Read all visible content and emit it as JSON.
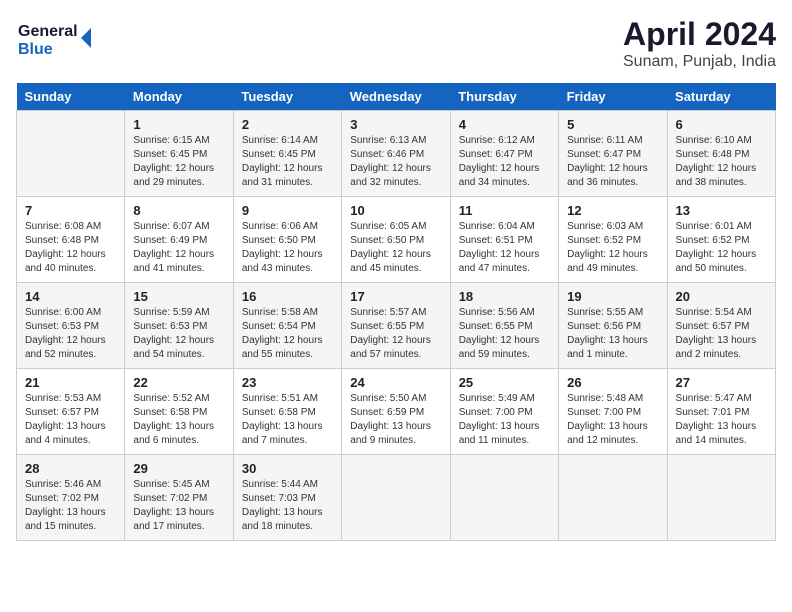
{
  "header": {
    "logo_line1": "General",
    "logo_line2": "Blue",
    "title": "April 2024",
    "subtitle": "Sunam, Punjab, India"
  },
  "days_of_week": [
    "Sunday",
    "Monday",
    "Tuesday",
    "Wednesday",
    "Thursday",
    "Friday",
    "Saturday"
  ],
  "weeks": [
    [
      {
        "day": "",
        "info": ""
      },
      {
        "day": "1",
        "info": "Sunrise: 6:15 AM\nSunset: 6:45 PM\nDaylight: 12 hours\nand 29 minutes."
      },
      {
        "day": "2",
        "info": "Sunrise: 6:14 AM\nSunset: 6:45 PM\nDaylight: 12 hours\nand 31 minutes."
      },
      {
        "day": "3",
        "info": "Sunrise: 6:13 AM\nSunset: 6:46 PM\nDaylight: 12 hours\nand 32 minutes."
      },
      {
        "day": "4",
        "info": "Sunrise: 6:12 AM\nSunset: 6:47 PM\nDaylight: 12 hours\nand 34 minutes."
      },
      {
        "day": "5",
        "info": "Sunrise: 6:11 AM\nSunset: 6:47 PM\nDaylight: 12 hours\nand 36 minutes."
      },
      {
        "day": "6",
        "info": "Sunrise: 6:10 AM\nSunset: 6:48 PM\nDaylight: 12 hours\nand 38 minutes."
      }
    ],
    [
      {
        "day": "7",
        "info": "Sunrise: 6:08 AM\nSunset: 6:48 PM\nDaylight: 12 hours\nand 40 minutes."
      },
      {
        "day": "8",
        "info": "Sunrise: 6:07 AM\nSunset: 6:49 PM\nDaylight: 12 hours\nand 41 minutes."
      },
      {
        "day": "9",
        "info": "Sunrise: 6:06 AM\nSunset: 6:50 PM\nDaylight: 12 hours\nand 43 minutes."
      },
      {
        "day": "10",
        "info": "Sunrise: 6:05 AM\nSunset: 6:50 PM\nDaylight: 12 hours\nand 45 minutes."
      },
      {
        "day": "11",
        "info": "Sunrise: 6:04 AM\nSunset: 6:51 PM\nDaylight: 12 hours\nand 47 minutes."
      },
      {
        "day": "12",
        "info": "Sunrise: 6:03 AM\nSunset: 6:52 PM\nDaylight: 12 hours\nand 49 minutes."
      },
      {
        "day": "13",
        "info": "Sunrise: 6:01 AM\nSunset: 6:52 PM\nDaylight: 12 hours\nand 50 minutes."
      }
    ],
    [
      {
        "day": "14",
        "info": "Sunrise: 6:00 AM\nSunset: 6:53 PM\nDaylight: 12 hours\nand 52 minutes."
      },
      {
        "day": "15",
        "info": "Sunrise: 5:59 AM\nSunset: 6:53 PM\nDaylight: 12 hours\nand 54 minutes."
      },
      {
        "day": "16",
        "info": "Sunrise: 5:58 AM\nSunset: 6:54 PM\nDaylight: 12 hours\nand 55 minutes."
      },
      {
        "day": "17",
        "info": "Sunrise: 5:57 AM\nSunset: 6:55 PM\nDaylight: 12 hours\nand 57 minutes."
      },
      {
        "day": "18",
        "info": "Sunrise: 5:56 AM\nSunset: 6:55 PM\nDaylight: 12 hours\nand 59 minutes."
      },
      {
        "day": "19",
        "info": "Sunrise: 5:55 AM\nSunset: 6:56 PM\nDaylight: 13 hours\nand 1 minute."
      },
      {
        "day": "20",
        "info": "Sunrise: 5:54 AM\nSunset: 6:57 PM\nDaylight: 13 hours\nand 2 minutes."
      }
    ],
    [
      {
        "day": "21",
        "info": "Sunrise: 5:53 AM\nSunset: 6:57 PM\nDaylight: 13 hours\nand 4 minutes."
      },
      {
        "day": "22",
        "info": "Sunrise: 5:52 AM\nSunset: 6:58 PM\nDaylight: 13 hours\nand 6 minutes."
      },
      {
        "day": "23",
        "info": "Sunrise: 5:51 AM\nSunset: 6:58 PM\nDaylight: 13 hours\nand 7 minutes."
      },
      {
        "day": "24",
        "info": "Sunrise: 5:50 AM\nSunset: 6:59 PM\nDaylight: 13 hours\nand 9 minutes."
      },
      {
        "day": "25",
        "info": "Sunrise: 5:49 AM\nSunset: 7:00 PM\nDaylight: 13 hours\nand 11 minutes."
      },
      {
        "day": "26",
        "info": "Sunrise: 5:48 AM\nSunset: 7:00 PM\nDaylight: 13 hours\nand 12 minutes."
      },
      {
        "day": "27",
        "info": "Sunrise: 5:47 AM\nSunset: 7:01 PM\nDaylight: 13 hours\nand 14 minutes."
      }
    ],
    [
      {
        "day": "28",
        "info": "Sunrise: 5:46 AM\nSunset: 7:02 PM\nDaylight: 13 hours\nand 15 minutes."
      },
      {
        "day": "29",
        "info": "Sunrise: 5:45 AM\nSunset: 7:02 PM\nDaylight: 13 hours\nand 17 minutes."
      },
      {
        "day": "30",
        "info": "Sunrise: 5:44 AM\nSunset: 7:03 PM\nDaylight: 13 hours\nand 18 minutes."
      },
      {
        "day": "",
        "info": ""
      },
      {
        "day": "",
        "info": ""
      },
      {
        "day": "",
        "info": ""
      },
      {
        "day": "",
        "info": ""
      }
    ]
  ]
}
